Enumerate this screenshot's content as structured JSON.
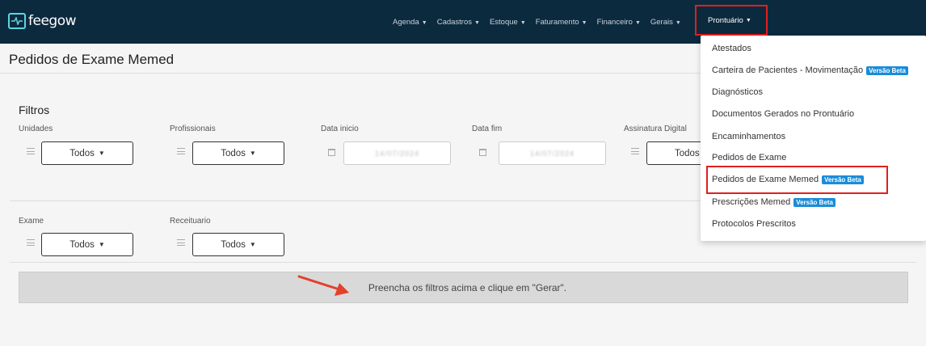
{
  "brand": {
    "name": "feegow"
  },
  "nav": {
    "items": [
      {
        "label": "Agenda"
      },
      {
        "label": "Cadastros"
      },
      {
        "label": "Estoque"
      },
      {
        "label": "Faturamento"
      },
      {
        "label": "Financeiro"
      },
      {
        "label": "Gerais"
      }
    ],
    "active": {
      "label": "Prontuário"
    }
  },
  "page": {
    "title": "Pedidos de Exame Memed"
  },
  "filters": {
    "title": "Filtros",
    "unidades": {
      "label": "Unidades",
      "value": "Todos"
    },
    "profissionais": {
      "label": "Profissionais",
      "value": "Todos"
    },
    "data_inicio": {
      "label": "Data inicio",
      "value": "14/07/2024"
    },
    "data_fim": {
      "label": "Data fim",
      "value": "14/07/2024"
    },
    "assinatura": {
      "label": "Assinatura Digital",
      "value": "Todos"
    },
    "exame": {
      "label": "Exame",
      "value": "Todos"
    },
    "receituario": {
      "label": "Receituario",
      "value": "Todos"
    }
  },
  "banner": {
    "text": "Preencha os filtros acima e clique em \"Gerar\"."
  },
  "dropdown": {
    "badge": "Versão Beta",
    "items": [
      {
        "label": "Atestados"
      },
      {
        "label": "Carteira de Pacientes - Movimentação"
      },
      {
        "label": "Diagnósticos"
      },
      {
        "label": "Documentos Gerados no Prontuário"
      },
      {
        "label": "Encaminhamentos"
      },
      {
        "label": "Pedidos de Exame"
      },
      {
        "label": "Pedidos de Exame Memed"
      },
      {
        "label": "Prescrições Memed"
      },
      {
        "label": "Protocolos Prescritos"
      }
    ]
  },
  "colors": {
    "topbar": "#0c2a3e",
    "accent": "#1a8cd8",
    "highlight": "#e0201e"
  }
}
